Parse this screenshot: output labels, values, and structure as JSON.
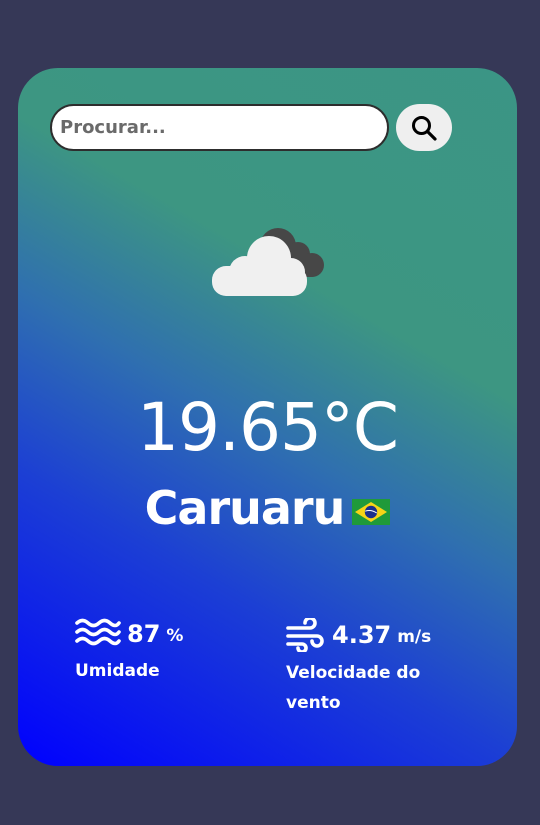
{
  "search": {
    "placeholder": "Procurar..."
  },
  "weather": {
    "icon": "cloud-icon",
    "temperature": "19.65°C",
    "city": "Caruaru",
    "country_flag": "brazil-flag-icon"
  },
  "humidity": {
    "icon": "water-waves-icon",
    "value": "87",
    "unit": "%",
    "label": "Umidade"
  },
  "wind": {
    "icon": "wind-icon",
    "value": "4.37",
    "unit": "m/s",
    "label": "Velocidade do vento"
  },
  "colors": {
    "page_background": "#363857",
    "card_gradient_start": "#0000ff",
    "card_gradient_end": "#3b9585",
    "text": "#ffffff"
  }
}
